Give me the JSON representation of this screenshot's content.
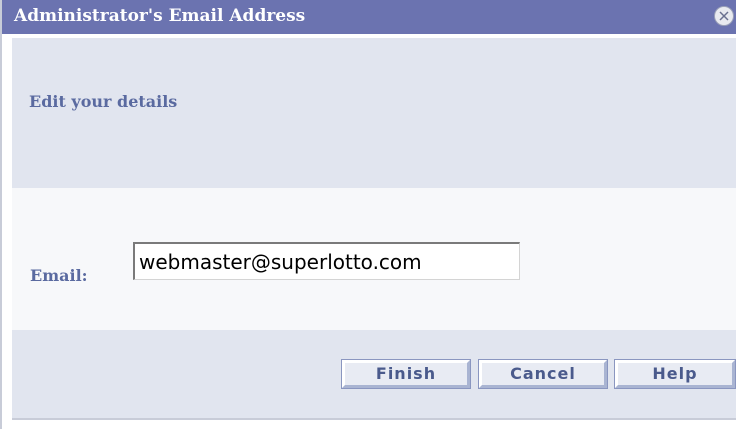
{
  "window": {
    "title": "Administrator's Email Address",
    "close_icon": "close-icon"
  },
  "header": {
    "subtitle": "Edit your details"
  },
  "form": {
    "email_label": "Email:",
    "email_value": "webmaster@superlotto.com"
  },
  "footer": {
    "finish_label": "Finish",
    "cancel_label": "Cancel",
    "help_label": "Help"
  },
  "colors": {
    "titlebar": "#6b73b0",
    "panel": "#e1e5ef",
    "label_text": "#5a6aa0"
  }
}
